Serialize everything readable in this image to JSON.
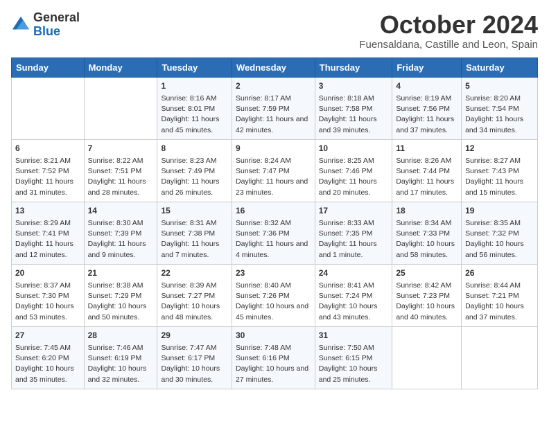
{
  "header": {
    "logo_general": "General",
    "logo_blue": "Blue",
    "month_title": "October 2024",
    "location": "Fuensaldana, Castille and Leon, Spain"
  },
  "calendar": {
    "days_of_week": [
      "Sunday",
      "Monday",
      "Tuesday",
      "Wednesday",
      "Thursday",
      "Friday",
      "Saturday"
    ],
    "weeks": [
      [
        {
          "day": "",
          "lines": []
        },
        {
          "day": "",
          "lines": []
        },
        {
          "day": "1",
          "lines": [
            "Sunrise: 8:16 AM",
            "Sunset: 8:01 PM",
            "Daylight: 11 hours and 45 minutes."
          ]
        },
        {
          "day": "2",
          "lines": [
            "Sunrise: 8:17 AM",
            "Sunset: 7:59 PM",
            "Daylight: 11 hours and 42 minutes."
          ]
        },
        {
          "day": "3",
          "lines": [
            "Sunrise: 8:18 AM",
            "Sunset: 7:58 PM",
            "Daylight: 11 hours and 39 minutes."
          ]
        },
        {
          "day": "4",
          "lines": [
            "Sunrise: 8:19 AM",
            "Sunset: 7:56 PM",
            "Daylight: 11 hours and 37 minutes."
          ]
        },
        {
          "day": "5",
          "lines": [
            "Sunrise: 8:20 AM",
            "Sunset: 7:54 PM",
            "Daylight: 11 hours and 34 minutes."
          ]
        }
      ],
      [
        {
          "day": "6",
          "lines": [
            "Sunrise: 8:21 AM",
            "Sunset: 7:52 PM",
            "Daylight: 11 hours and 31 minutes."
          ]
        },
        {
          "day": "7",
          "lines": [
            "Sunrise: 8:22 AM",
            "Sunset: 7:51 PM",
            "Daylight: 11 hours and 28 minutes."
          ]
        },
        {
          "day": "8",
          "lines": [
            "Sunrise: 8:23 AM",
            "Sunset: 7:49 PM",
            "Daylight: 11 hours and 26 minutes."
          ]
        },
        {
          "day": "9",
          "lines": [
            "Sunrise: 8:24 AM",
            "Sunset: 7:47 PM",
            "Daylight: 11 hours and 23 minutes."
          ]
        },
        {
          "day": "10",
          "lines": [
            "Sunrise: 8:25 AM",
            "Sunset: 7:46 PM",
            "Daylight: 11 hours and 20 minutes."
          ]
        },
        {
          "day": "11",
          "lines": [
            "Sunrise: 8:26 AM",
            "Sunset: 7:44 PM",
            "Daylight: 11 hours and 17 minutes."
          ]
        },
        {
          "day": "12",
          "lines": [
            "Sunrise: 8:27 AM",
            "Sunset: 7:43 PM",
            "Daylight: 11 hours and 15 minutes."
          ]
        }
      ],
      [
        {
          "day": "13",
          "lines": [
            "Sunrise: 8:29 AM",
            "Sunset: 7:41 PM",
            "Daylight: 11 hours and 12 minutes."
          ]
        },
        {
          "day": "14",
          "lines": [
            "Sunrise: 8:30 AM",
            "Sunset: 7:39 PM",
            "Daylight: 11 hours and 9 minutes."
          ]
        },
        {
          "day": "15",
          "lines": [
            "Sunrise: 8:31 AM",
            "Sunset: 7:38 PM",
            "Daylight: 11 hours and 7 minutes."
          ]
        },
        {
          "day": "16",
          "lines": [
            "Sunrise: 8:32 AM",
            "Sunset: 7:36 PM",
            "Daylight: 11 hours and 4 minutes."
          ]
        },
        {
          "day": "17",
          "lines": [
            "Sunrise: 8:33 AM",
            "Sunset: 7:35 PM",
            "Daylight: 11 hours and 1 minute."
          ]
        },
        {
          "day": "18",
          "lines": [
            "Sunrise: 8:34 AM",
            "Sunset: 7:33 PM",
            "Daylight: 10 hours and 58 minutes."
          ]
        },
        {
          "day": "19",
          "lines": [
            "Sunrise: 8:35 AM",
            "Sunset: 7:32 PM",
            "Daylight: 10 hours and 56 minutes."
          ]
        }
      ],
      [
        {
          "day": "20",
          "lines": [
            "Sunrise: 8:37 AM",
            "Sunset: 7:30 PM",
            "Daylight: 10 hours and 53 minutes."
          ]
        },
        {
          "day": "21",
          "lines": [
            "Sunrise: 8:38 AM",
            "Sunset: 7:29 PM",
            "Daylight: 10 hours and 50 minutes."
          ]
        },
        {
          "day": "22",
          "lines": [
            "Sunrise: 8:39 AM",
            "Sunset: 7:27 PM",
            "Daylight: 10 hours and 48 minutes."
          ]
        },
        {
          "day": "23",
          "lines": [
            "Sunrise: 8:40 AM",
            "Sunset: 7:26 PM",
            "Daylight: 10 hours and 45 minutes."
          ]
        },
        {
          "day": "24",
          "lines": [
            "Sunrise: 8:41 AM",
            "Sunset: 7:24 PM",
            "Daylight: 10 hours and 43 minutes."
          ]
        },
        {
          "day": "25",
          "lines": [
            "Sunrise: 8:42 AM",
            "Sunset: 7:23 PM",
            "Daylight: 10 hours and 40 minutes."
          ]
        },
        {
          "day": "26",
          "lines": [
            "Sunrise: 8:44 AM",
            "Sunset: 7:21 PM",
            "Daylight: 10 hours and 37 minutes."
          ]
        }
      ],
      [
        {
          "day": "27",
          "lines": [
            "Sunrise: 7:45 AM",
            "Sunset: 6:20 PM",
            "Daylight: 10 hours and 35 minutes."
          ]
        },
        {
          "day": "28",
          "lines": [
            "Sunrise: 7:46 AM",
            "Sunset: 6:19 PM",
            "Daylight: 10 hours and 32 minutes."
          ]
        },
        {
          "day": "29",
          "lines": [
            "Sunrise: 7:47 AM",
            "Sunset: 6:17 PM",
            "Daylight: 10 hours and 30 minutes."
          ]
        },
        {
          "day": "30",
          "lines": [
            "Sunrise: 7:48 AM",
            "Sunset: 6:16 PM",
            "Daylight: 10 hours and 27 minutes."
          ]
        },
        {
          "day": "31",
          "lines": [
            "Sunrise: 7:50 AM",
            "Sunset: 6:15 PM",
            "Daylight: 10 hours and 25 minutes."
          ]
        },
        {
          "day": "",
          "lines": []
        },
        {
          "day": "",
          "lines": []
        }
      ]
    ]
  }
}
